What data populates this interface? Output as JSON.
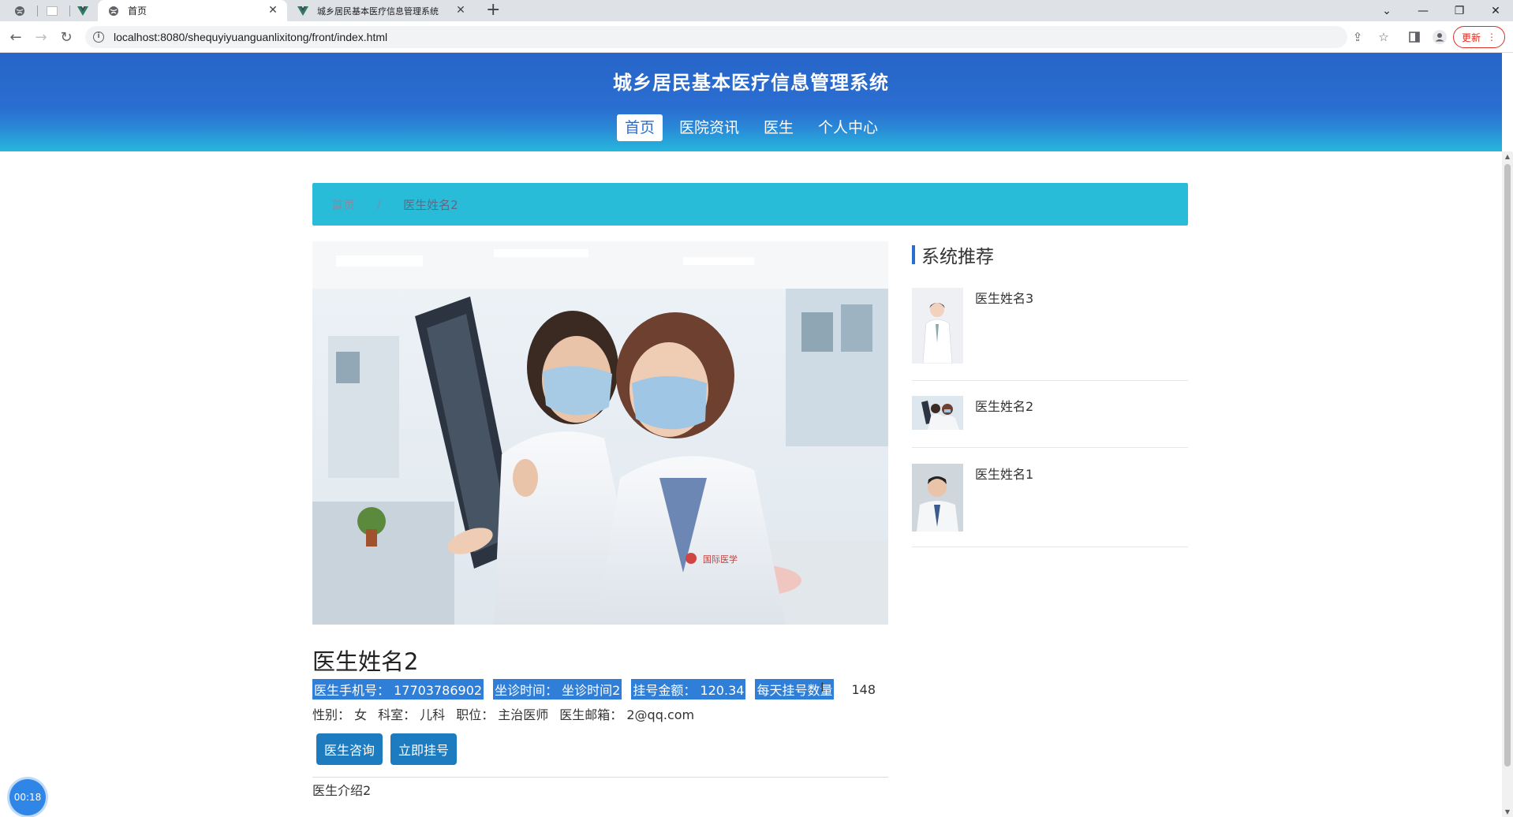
{
  "browser": {
    "tabs": [
      {
        "title": "首页"
      },
      {
        "title": "城乡居民基本医疗信息管理系统"
      }
    ],
    "url": "localhost:8080/shequyiyuanguanlixitong/front/index.html",
    "update_label": "更新"
  },
  "site": {
    "title": "城乡居民基本医疗信息管理系统",
    "nav": [
      "首页",
      "医院资讯",
      "医生",
      "个人中心"
    ]
  },
  "breadcrumb": {
    "home": "首页",
    "separator": "/",
    "current": "医生姓名2"
  },
  "doctor": {
    "name": "医生姓名2",
    "phone": "医生手机号： 17703786902",
    "time": "坐诊时间： 坐诊时间2",
    "fee": "挂号金额： 120.34",
    "daily_label": "每天挂号数量",
    "daily_value": "148",
    "gender": "性别： 女",
    "department": "科室： 儿科",
    "title": "职位： 主治医师",
    "email": "医生邮箱： 2@qq.com",
    "consult_button": "医生咨询",
    "register_button": "立即挂号",
    "intro": "医生介绍2"
  },
  "sidebar": {
    "title": "系统推荐",
    "items": [
      {
        "name": "医生姓名3"
      },
      {
        "name": "医生姓名2"
      },
      {
        "name": "医生姓名1"
      }
    ]
  },
  "timer": "00:18"
}
